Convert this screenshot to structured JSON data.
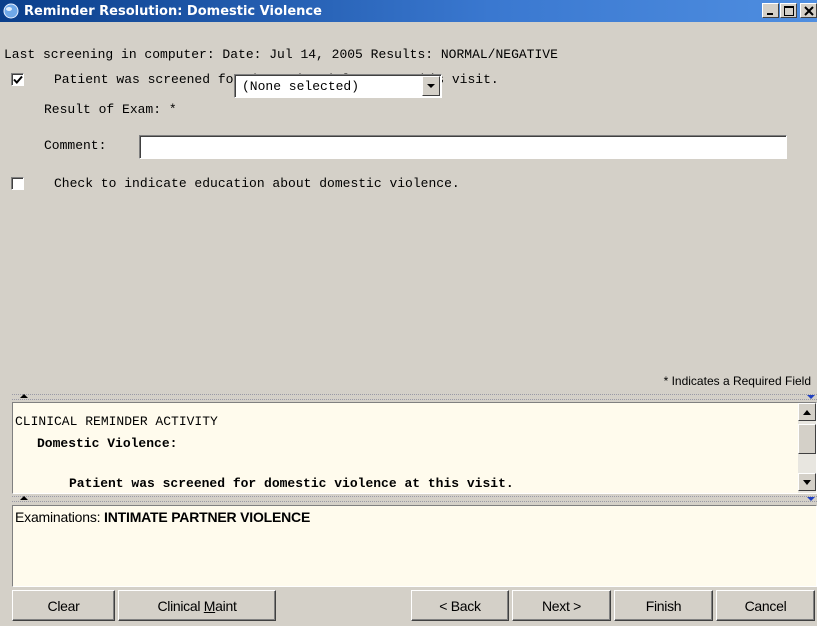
{
  "window": {
    "title": "Reminder Resolution: Domestic Violence",
    "controls": {
      "minimize": "_",
      "maximize": "□",
      "close": "X"
    }
  },
  "form": {
    "last_screening": "Last screening in computer: Date: Jul 14, 2005 Results: NORMAL/NEGATIVE",
    "screened_checkbox": {
      "checked": true,
      "label": "Patient was screened for domestic violence at this visit."
    },
    "result_of_exam": {
      "label": "Result of Exam: *",
      "selected": "(None selected)"
    },
    "comment": {
      "label": "Comment:",
      "value": ""
    },
    "education_checkbox": {
      "checked": false,
      "label": "Check to indicate education about domestic violence."
    },
    "required_note": "* Indicates a Required Field"
  },
  "activity": {
    "heading": "CLINICAL REMINDER ACTIVITY",
    "subheading": "Domestic Violence:",
    "detail": "Patient was screened for domestic violence at this visit."
  },
  "summary": {
    "label": "Examinations:",
    "value": "INTIMATE PARTNER VIOLENCE"
  },
  "buttons": {
    "clear": "Clear",
    "clinical_maint_prefix": "Clinical ",
    "clinical_maint_underlined": "M",
    "clinical_maint_suffix": "aint",
    "back": "< Back",
    "next": "Next >",
    "finish": "Finish",
    "cancel": "Cancel"
  }
}
